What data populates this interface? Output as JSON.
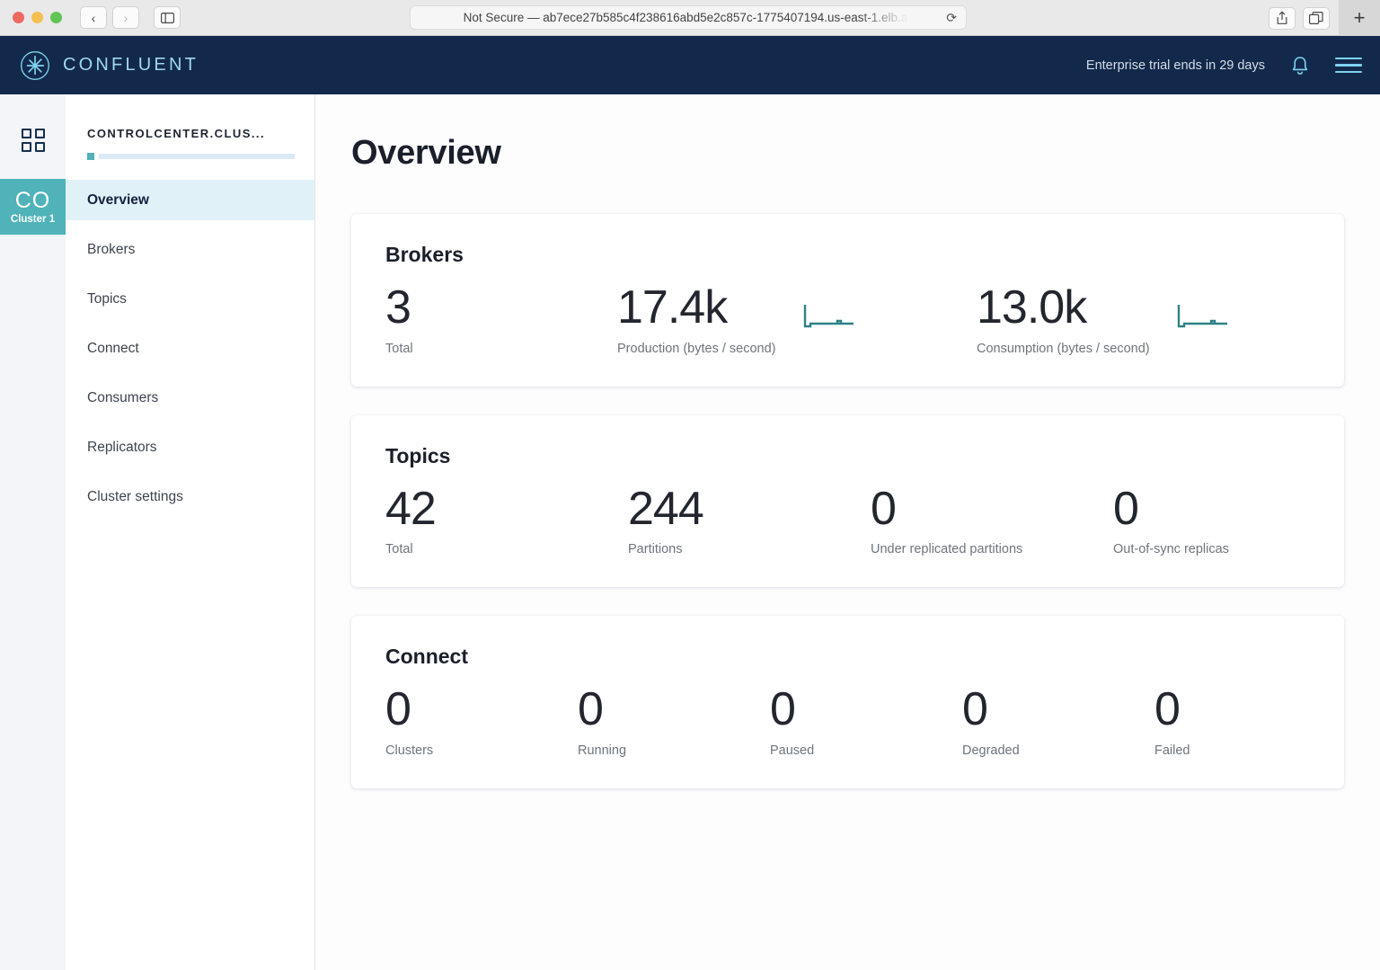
{
  "browser": {
    "back_label": "‹",
    "forward_label": "›",
    "sidebar_icon": "sidebar-icon",
    "url_text": "Not Secure — ab7ece27b585c4f238616abd5e2c857c-1775407194.us-east-1.elb.a",
    "reload_label": "⟳",
    "share_icon": "share-icon",
    "tabs_icon": "tab-overview-icon",
    "new_tab_label": "+"
  },
  "header": {
    "brand": "CONFLUENT",
    "trial_notice": "Enterprise trial ends in 29 days",
    "bell_icon": "notification-bell-icon",
    "menu_icon": "hamburger-menu-icon",
    "background": "#13294b",
    "brand_color": "#9fd8ef"
  },
  "rail": {
    "grid_icon": "app-grid-icon",
    "cluster": {
      "abbrev": "CO",
      "name": "Cluster 1",
      "color": "#4fb3b9"
    }
  },
  "sidebar": {
    "cluster_title": "CONTROLCENTER.CLUS...",
    "accent_color": "#4fb3b9",
    "items": [
      {
        "label": "Overview",
        "active": true
      },
      {
        "label": "Brokers",
        "active": false
      },
      {
        "label": "Topics",
        "active": false
      },
      {
        "label": "Connect",
        "active": false
      },
      {
        "label": "Consumers",
        "active": false
      },
      {
        "label": "Replicators",
        "active": false
      },
      {
        "label": "Cluster settings",
        "active": false
      }
    ]
  },
  "main": {
    "page_title": "Overview",
    "cards": [
      {
        "title": "Brokers",
        "metrics": [
          {
            "value": "3",
            "label": "Total",
            "spark": false
          },
          {
            "value": "17.4k",
            "label": "Production (bytes / second)",
            "spark": true
          },
          {
            "value": "13.0k",
            "label": "Consumption (bytes / second)",
            "spark": true
          }
        ]
      },
      {
        "title": "Topics",
        "metrics": [
          {
            "value": "42",
            "label": "Total",
            "spark": false
          },
          {
            "value": "244",
            "label": "Partitions",
            "spark": false
          },
          {
            "value": "0",
            "label": "Under replicated partitions",
            "spark": false
          },
          {
            "value": "0",
            "label": "Out-of-sync replicas",
            "spark": false
          }
        ]
      },
      {
        "title": "Connect",
        "metrics": [
          {
            "value": "0",
            "label": "Clusters",
            "spark": false
          },
          {
            "value": "0",
            "label": "Running",
            "spark": false
          },
          {
            "value": "0",
            "label": "Paused",
            "spark": false
          },
          {
            "value": "0",
            "label": "Degraded",
            "spark": false
          },
          {
            "value": "0",
            "label": "Failed",
            "spark": false
          }
        ]
      }
    ],
    "sparkline_color": "#2e8186"
  }
}
